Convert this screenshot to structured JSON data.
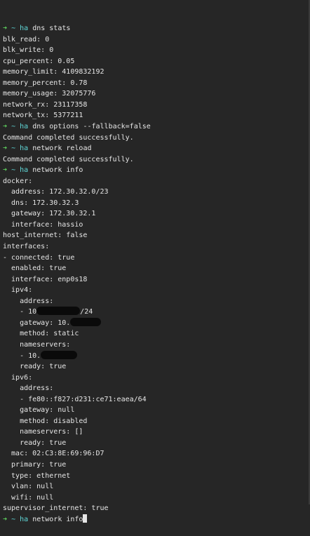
{
  "terminal": {
    "prompt_arrow": "➜",
    "prompt_dir": "~",
    "lines": [
      {
        "kind": "prompt",
        "cmd": "ha",
        "args": "dns stats"
      },
      {
        "kind": "out",
        "text": "blk_read: 0"
      },
      {
        "kind": "out",
        "text": "blk_write: 0"
      },
      {
        "kind": "out",
        "text": "cpu_percent: 0.05"
      },
      {
        "kind": "out",
        "text": "memory_limit: 4109832192"
      },
      {
        "kind": "out",
        "text": "memory_percent: 0.78"
      },
      {
        "kind": "out",
        "text": "memory_usage: 32075776"
      },
      {
        "kind": "out",
        "text": "network_rx: 23117358"
      },
      {
        "kind": "out",
        "text": "network_tx: 5377211"
      },
      {
        "kind": "prompt",
        "cmd": "ha",
        "args": "dns options --fallback=false"
      },
      {
        "kind": "out",
        "text": "Command completed successfully."
      },
      {
        "kind": "prompt",
        "cmd": "ha",
        "args": "network reload"
      },
      {
        "kind": "out",
        "text": "Command completed successfully."
      },
      {
        "kind": "prompt",
        "cmd": "ha",
        "args": "network info"
      },
      {
        "kind": "out",
        "text": "docker:"
      },
      {
        "kind": "out",
        "text": "  address: 172.30.32.0/23"
      },
      {
        "kind": "out",
        "text": "  dns: 172.30.32.3"
      },
      {
        "kind": "out",
        "text": "  gateway: 172.30.32.1"
      },
      {
        "kind": "out",
        "text": "  interface: hassio"
      },
      {
        "kind": "out",
        "text": "host_internet: false"
      },
      {
        "kind": "out",
        "text": "interfaces:"
      },
      {
        "kind": "out",
        "text": "- connected: true"
      },
      {
        "kind": "out",
        "text": "  enabled: true"
      },
      {
        "kind": "out",
        "text": "  interface: enp0s18"
      },
      {
        "kind": "out",
        "text": "  ipv4:"
      },
      {
        "kind": "out",
        "text": "    address:"
      },
      {
        "kind": "redacted",
        "before": "    - 10",
        "after": "/24",
        "blot": 62
      },
      {
        "kind": "redacted",
        "before": "    gateway: 10.",
        "after": "",
        "blot": 44
      },
      {
        "kind": "out",
        "text": "    method: static"
      },
      {
        "kind": "out",
        "text": "    nameservers:"
      },
      {
        "kind": "redacted",
        "before": "    - 10.",
        "after": "",
        "blot": 52
      },
      {
        "kind": "out",
        "text": "    ready: true"
      },
      {
        "kind": "out",
        "text": "  ipv6:"
      },
      {
        "kind": "out",
        "text": "    address:"
      },
      {
        "kind": "out",
        "text": "    - fe80::f827:d231:ce71:eaea/64"
      },
      {
        "kind": "out",
        "text": "    gateway: null"
      },
      {
        "kind": "out",
        "text": "    method: disabled"
      },
      {
        "kind": "out",
        "text": "    nameservers: []"
      },
      {
        "kind": "out",
        "text": "    ready: true"
      },
      {
        "kind": "out",
        "text": "  mac: 02:C3:8E:69:96:D7"
      },
      {
        "kind": "out",
        "text": "  primary: true"
      },
      {
        "kind": "out",
        "text": "  type: ethernet"
      },
      {
        "kind": "out",
        "text": "  vlan: null"
      },
      {
        "kind": "out",
        "text": "  wifi: null"
      },
      {
        "kind": "out",
        "text": "supervisor_internet: true"
      },
      {
        "kind": "prompt_active",
        "cmd": "ha",
        "args": "network info"
      }
    ]
  },
  "colors": {
    "background": "#262626",
    "prompt_arrow": "#5fd35f",
    "prompt_cyan": "#5fd7d7",
    "text": "#e6e6e6"
  }
}
